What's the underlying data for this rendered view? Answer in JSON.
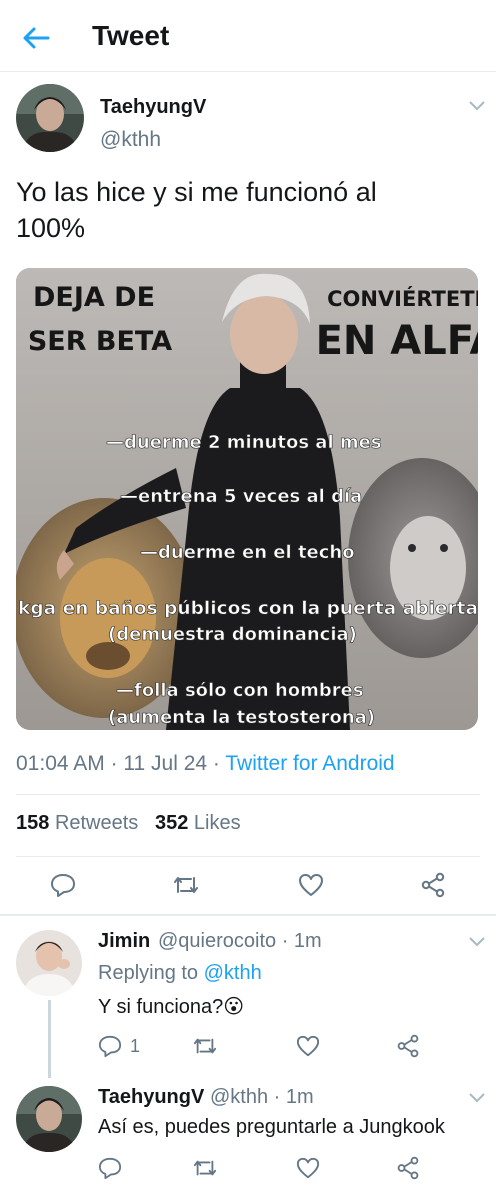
{
  "header": {
    "title": "Tweet"
  },
  "tweet": {
    "author_name": "TaehyungV",
    "author_handle": "@kthh",
    "text_line1": "Yo las hice y si me funcionó al",
    "text_line2": "100%",
    "time": "01:04 AM",
    "date": "11 Jul 24",
    "source": "Twitter for Android",
    "retweets_count": "158",
    "retweets_label": "Retweets",
    "likes_count": "352",
    "likes_label": "Likes"
  },
  "image": {
    "left_title_1": "DEJA DE",
    "left_title_2": "SER BETA",
    "right_title_1": "CONVIÉRTETE",
    "right_title_2": "EN ALFA",
    "line1": "—duerme 2 minutos al mes",
    "line2": "—entrena 5 veces al día",
    "line3": "—duerme en el techo",
    "line4": "kga en baños públicos con la puerta abierta",
    "line5": "(demuestra dominancia)",
    "line6": "—folla sólo con hombres",
    "line7": "(aumenta la testosterona)"
  },
  "replies": [
    {
      "name": "Jimin",
      "handle": "@quierocoito",
      "time": "· 1m",
      "replying_prefix": "Replying to",
      "replying_to": "@kthh",
      "text": "Y si funciona?",
      "emoji": "😮",
      "reply_count": "1"
    },
    {
      "name": "TaehyungV",
      "handle": "@kthh",
      "time": "· 1m",
      "text": "Así es, puedes preguntarle a Jungkook"
    }
  ],
  "colors": {
    "accent": "#1da1f2",
    "secondary_text": "#657786",
    "border": "#e6ecf0"
  },
  "icons": [
    "back-arrow-icon",
    "chevron-down-icon",
    "reply-icon",
    "retweet-icon",
    "like-icon",
    "share-icon"
  ]
}
